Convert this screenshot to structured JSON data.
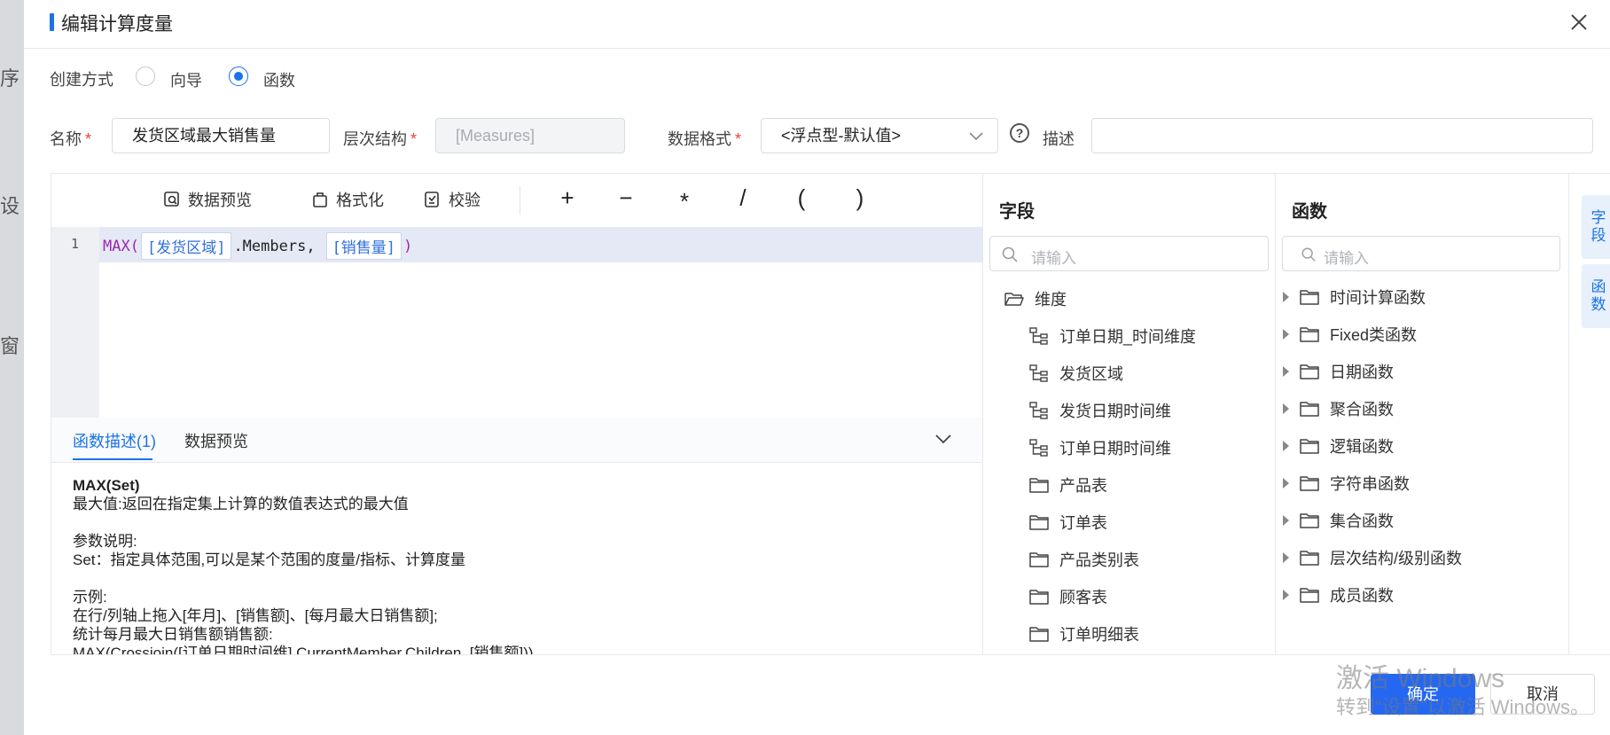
{
  "backdrop": {
    "glyphs": [
      "序",
      "设",
      "窗"
    ]
  },
  "dialog": {
    "title": "编辑计算度量"
  },
  "create_mode": {
    "label": "创建方式",
    "options": [
      {
        "label": "向导",
        "selected": false
      },
      {
        "label": "函数",
        "selected": true
      }
    ]
  },
  "form": {
    "name_label": "名称",
    "name_value": "发货区域最大销售量",
    "hierarchy_label": "层次结构",
    "hierarchy_value": "[Measures]",
    "format_label": "数据格式",
    "format_value": "<浮点型-默认值>",
    "desc_label": "描述",
    "desc_value": "",
    "required_mark": "*",
    "help_glyph": "?"
  },
  "toolbar": {
    "preview_label": "数据预览",
    "format_label": "格式化",
    "validate_label": "校验",
    "operators": [
      "+",
      "−",
      "*",
      "/",
      "(",
      ")"
    ]
  },
  "editor": {
    "line_number": "1",
    "fn": "MAX(",
    "token1": "[发货区域]",
    "mid": ".Members,",
    "token2": "[销售量]",
    "close": ")"
  },
  "bottom_tabs": {
    "desc_tab": "函数描述(1)",
    "preview_tab": "数据预览"
  },
  "description": {
    "heading": "MAX(Set)",
    "summary": "最大值:返回在指定集上计算的数值表达式的最大值",
    "params_title": "参数说明:",
    "params_text": "Set：指定具体范围,可以是某个范围的度量/指标、计算度量",
    "example_title": "示例:",
    "example_line1": "在行/列轴上拖入[年月]、[销售额]、[每月最大日销售额];",
    "example_line2": "统计每月最大日销售额销售额:",
    "example_line3": "MAX(Crossjoin([订单日期时间维].CurrentMember.Children, [销售额]))"
  },
  "fields": {
    "title": "字段",
    "search_placeholder": "请输入",
    "root": "维度",
    "items": [
      {
        "label": "订单日期_时间维度",
        "icon": "hierarchy-icon"
      },
      {
        "label": "发货区域",
        "icon": "hierarchy-icon"
      },
      {
        "label": "发货日期时间维",
        "icon": "hierarchy-icon"
      },
      {
        "label": "订单日期时间维",
        "icon": "hierarchy-icon"
      },
      {
        "label": "产品表",
        "icon": "folder-icon"
      },
      {
        "label": "订单表",
        "icon": "folder-icon"
      },
      {
        "label": "产品类别表",
        "icon": "folder-icon"
      },
      {
        "label": "顾客表",
        "icon": "folder-icon"
      },
      {
        "label": "订单明细表",
        "icon": "folder-icon"
      }
    ]
  },
  "functions": {
    "title": "函数",
    "search_placeholder": "请输入",
    "items": [
      "时间计算函数",
      "Fixed类函数",
      "日期函数",
      "聚合函数",
      "逻辑函数",
      "字符串函数",
      "集合函数",
      "层次结构/级别函数",
      "成员函数"
    ]
  },
  "side_tabs": {
    "fields": "字段",
    "functions": "函数"
  },
  "buttons": {
    "ok": "确定",
    "cancel": "取消"
  },
  "watermark": {
    "line1": "激活 Windows",
    "line2": "转到“设置”以激活 Windows。"
  },
  "colors": {
    "accent": "#1a73e8",
    "primary_button": "#2468f2",
    "required": "#f04134"
  }
}
